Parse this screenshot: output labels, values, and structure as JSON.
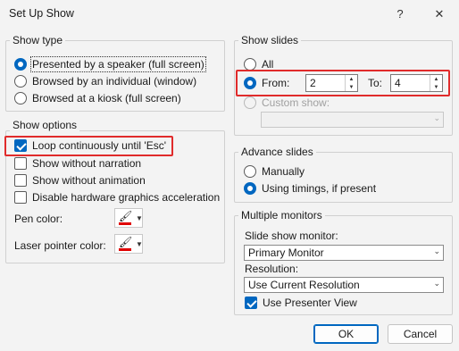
{
  "window": {
    "title": "Set Up Show",
    "help_label": "?",
    "close_label": "✕"
  },
  "show_type": {
    "label": "Show type",
    "options": [
      {
        "label": "Presented by a speaker (full screen)",
        "selected": true
      },
      {
        "label": "Browsed by an individual (window)",
        "selected": false
      },
      {
        "label": "Browsed at a kiosk (full screen)",
        "selected": false
      }
    ]
  },
  "show_options": {
    "label": "Show options",
    "checks": [
      {
        "label": "Loop continuously until 'Esc'",
        "checked": true
      },
      {
        "label": "Show without narration",
        "checked": false
      },
      {
        "label": "Show without animation",
        "checked": false
      },
      {
        "label": "Disable hardware graphics acceleration",
        "checked": false
      }
    ],
    "pen_color_label": "Pen color:",
    "laser_color_label": "Laser pointer color:",
    "pen_color": "#e00000",
    "laser_color": "#e00000"
  },
  "show_slides": {
    "label": "Show slides",
    "all_label": "All",
    "from_label": "From:",
    "from_value": "2",
    "to_label": "To:",
    "to_value": "4",
    "custom_label": "Custom show:",
    "custom_value": ""
  },
  "advance_slides": {
    "label": "Advance slides",
    "manually_label": "Manually",
    "timings_label": "Using timings, if present"
  },
  "monitors": {
    "label": "Multiple monitors",
    "monitor_label": "Slide show monitor:",
    "monitor_value": "Primary Monitor",
    "resolution_label": "Resolution:",
    "resolution_value": "Use Current Resolution",
    "presenter_view_label": "Use Presenter View",
    "presenter_view_checked": true
  },
  "buttons": {
    "ok": "OK",
    "cancel": "Cancel"
  },
  "colors": {
    "accent": "#0067c0",
    "highlight": "#e02b2b"
  }
}
